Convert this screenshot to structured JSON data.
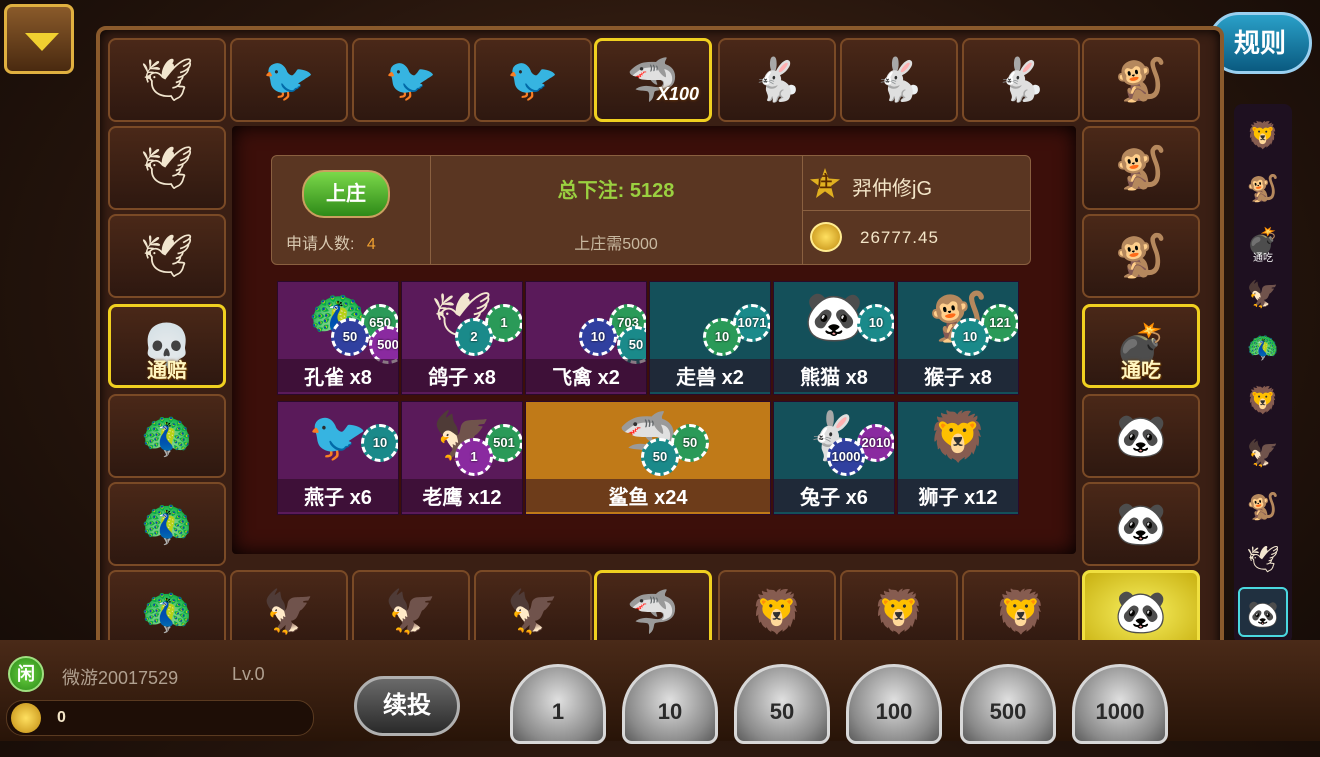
{
  "rules_label": "规则",
  "top_row": [
    {
      "animal": "dove",
      "icon": "🕊"
    },
    {
      "animal": "swallow",
      "icon": "🐦"
    },
    {
      "animal": "swallow",
      "icon": "🐦"
    },
    {
      "animal": "swallow",
      "icon": "🐦"
    },
    {
      "animal": "shark",
      "icon": "🦈",
      "special": "gold",
      "mult": "X100"
    },
    {
      "animal": "rabbit",
      "icon": "🐇"
    },
    {
      "animal": "rabbit",
      "icon": "🐇"
    },
    {
      "animal": "rabbit",
      "icon": "🐇"
    },
    {
      "animal": "monkey",
      "icon": "🐒"
    }
  ],
  "left_col": [
    {
      "animal": "dove",
      "icon": "🕊"
    },
    {
      "animal": "dove",
      "icon": "🕊"
    },
    {
      "animal": "skull",
      "icon": "💀",
      "special": "gold",
      "label": "通赔"
    },
    {
      "animal": "peacock",
      "icon": "🦚"
    },
    {
      "animal": "peacock",
      "icon": "🦚"
    }
  ],
  "right_col": [
    {
      "animal": "monkey",
      "icon": "🐒"
    },
    {
      "animal": "monkey",
      "icon": "🐒"
    },
    {
      "animal": "bomb",
      "icon": "💣",
      "special": "gold",
      "label": "通吃"
    },
    {
      "animal": "panda",
      "icon": "🐼"
    },
    {
      "animal": "panda",
      "icon": "🐼"
    }
  ],
  "bottom_row": [
    {
      "animal": "peacock",
      "icon": "🦚"
    },
    {
      "animal": "eagle",
      "icon": "🦅"
    },
    {
      "animal": "eagle",
      "icon": "🦅"
    },
    {
      "animal": "eagle",
      "icon": "🦅"
    },
    {
      "animal": "shark",
      "icon": "🦈",
      "special": "gold"
    },
    {
      "animal": "lion",
      "icon": "🦁"
    },
    {
      "animal": "lion",
      "icon": "🦁"
    },
    {
      "animal": "lion",
      "icon": "🦁"
    },
    {
      "animal": "panda",
      "icon": "🐼",
      "special": "lit"
    }
  ],
  "banker": {
    "button_label": "上庄",
    "applicants_label": "申请人数:",
    "applicants_count": "4",
    "total_bet_label": "总下注:",
    "total_bet_value": "5128",
    "requirement": "上庄需5000",
    "name_badge": "庄",
    "name": "羿仲修jG",
    "coins": "26777.45"
  },
  "bets": [
    {
      "label": "孔雀 x8",
      "icon": "🦚",
      "bg": "purple",
      "chips": [
        {
          "v": "650",
          "c": "g"
        },
        {
          "v": "50",
          "c": "b"
        },
        {
          "v": "500",
          "c": "p"
        }
      ]
    },
    {
      "label": "鸽子 x8",
      "icon": "🕊",
      "bg": "purple",
      "chips": [
        {
          "v": "1",
          "c": "g"
        },
        {
          "v": "2",
          "c": "t"
        }
      ]
    },
    {
      "label": "飞禽 x2",
      "icon": "",
      "bg": "purple",
      "chips": [
        {
          "v": "703",
          "c": "g"
        },
        {
          "v": "10",
          "c": "b"
        },
        {
          "v": "50",
          "c": "t"
        }
      ]
    },
    {
      "label": "走兽 x2",
      "icon": "",
      "bg": "teal",
      "chips": [
        {
          "v": "1071",
          "c": "t"
        },
        {
          "v": "10",
          "c": "g"
        }
      ]
    },
    {
      "label": "熊猫 x8",
      "icon": "🐼",
      "bg": "teal",
      "chips": [
        {
          "v": "10",
          "c": "t"
        }
      ]
    },
    {
      "label": "猴子 x8",
      "icon": "🐒",
      "bg": "teal",
      "chips": [
        {
          "v": "121",
          "c": "g"
        },
        {
          "v": "10",
          "c": "t"
        }
      ]
    },
    {
      "label": "燕子 x6",
      "icon": "🐦",
      "bg": "purple",
      "chips": [
        {
          "v": "10",
          "c": "t"
        }
      ]
    },
    {
      "label": "老鹰 x12",
      "icon": "🦅",
      "bg": "purple",
      "chips": [
        {
          "v": "501",
          "c": "g"
        },
        {
          "v": "1",
          "c": "p"
        }
      ]
    },
    {
      "label": "鲨鱼 x24",
      "icon": "🦈",
      "bg": "orange",
      "chips": [
        {
          "v": "50",
          "c": "g"
        },
        {
          "v": "50",
          "c": "t"
        }
      ]
    },
    {
      "label": "兔子 x6",
      "icon": "🐇",
      "bg": "teal",
      "chips": [
        {
          "v": "2010",
          "c": "p"
        },
        {
          "v": "1000",
          "c": "b"
        }
      ]
    },
    {
      "label": "狮子 x12",
      "icon": "🦁",
      "bg": "teal",
      "chips": []
    }
  ],
  "history": [
    {
      "icon": "🦁"
    },
    {
      "icon": "🐒"
    },
    {
      "icon": "💣",
      "label": "通吃"
    },
    {
      "icon": "🦅"
    },
    {
      "icon": "🦚"
    },
    {
      "icon": "🦁"
    },
    {
      "icon": "🦅"
    },
    {
      "icon": "🐒"
    },
    {
      "icon": "🕊"
    },
    {
      "icon": "🐼",
      "selected": true
    }
  ],
  "player": {
    "role_badge": "闲",
    "name": "微游20017529",
    "level": "Lv.0",
    "coins": "0"
  },
  "rebet_label": "续投",
  "chip_options": [
    "1",
    "10",
    "50",
    "100",
    "500",
    "1000"
  ]
}
